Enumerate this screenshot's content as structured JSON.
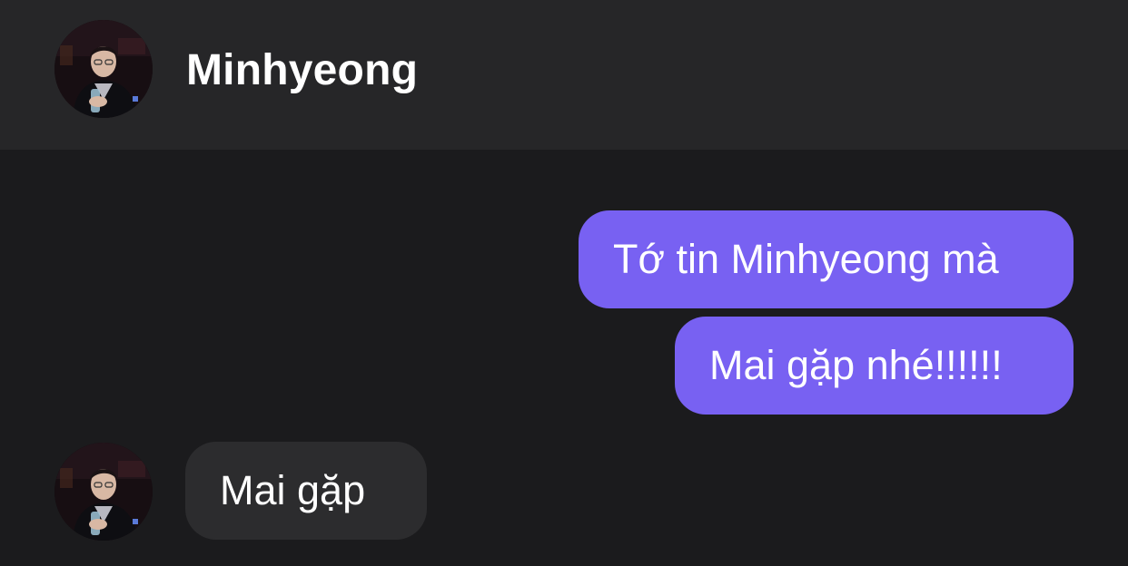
{
  "header": {
    "contact_name": "Minhyeong",
    "avatar_icon": "profile-photo"
  },
  "messages": [
    {
      "direction": "outgoing",
      "text": "Tớ tin Minhyeong mà"
    },
    {
      "direction": "outgoing",
      "text": "Mai gặp nhé!!!!!!"
    },
    {
      "direction": "incoming",
      "text": "Mai gặp"
    }
  ],
  "colors": {
    "header_bg": "#262628",
    "thread_bg": "#1b1b1d",
    "outgoing_bubble": "#7861f2",
    "incoming_bubble": "#2c2c2e",
    "text": "#ffffff"
  }
}
